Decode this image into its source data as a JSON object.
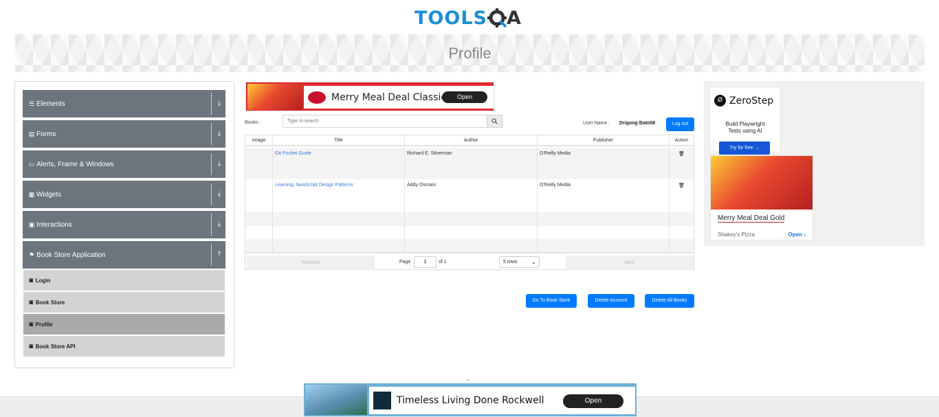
{
  "logo": {
    "text_part": "TOOLS",
    "text_end": "A"
  },
  "page_title": "Profile",
  "sidebar": {
    "groups": [
      {
        "label": "Elements",
        "icon": "list-icon",
        "arrow": "download-arrow-icon"
      },
      {
        "label": "Forms",
        "icon": "file-icon",
        "arrow": "download-arrow-icon"
      },
      {
        "label": "Alerts, Frame & Windows",
        "icon": "window-icon",
        "arrow": "download-arrow-icon"
      },
      {
        "label": "Widgets",
        "icon": "grid-icon",
        "arrow": "download-arrow-icon"
      },
      {
        "label": "Interactions",
        "icon": "interaction-icon",
        "arrow": "download-arrow-icon"
      },
      {
        "label": "Book Store Application",
        "icon": "book-icon",
        "arrow": "upload-arrow-icon"
      }
    ],
    "items": [
      {
        "label": "Login",
        "active": false
      },
      {
        "label": "Book Store",
        "active": false
      },
      {
        "label": "Profile",
        "active": true
      },
      {
        "label": "Book Store API",
        "active": false
      }
    ]
  },
  "ads": {
    "top": {
      "text": "Merry Meal Deal Classic",
      "button": "Open"
    },
    "right_zero": {
      "brand": "ZeroStep",
      "tagline": "Build Playwright Tests using AI",
      "button": "Try for free →"
    },
    "right_meal": {
      "title": "Merry Meal Deal Gold",
      "advertiser": "Shakey's Pizza",
      "open": "Open"
    },
    "bottom": {
      "text": "Timeless Living Done Rockwell",
      "button": "Open"
    }
  },
  "profile": {
    "books_label": "Books :",
    "search_placeholder": "Type to search",
    "user_name_label": "User Name :",
    "user_name_value": "Drigong Bato08",
    "logout_label": "Log out"
  },
  "table": {
    "headers": [
      "Image",
      "Title",
      "Author",
      "Publisher",
      "Action"
    ],
    "rows": [
      {
        "image": "",
        "title": "Git Pocket Guide",
        "author": "Richard E. Silverman",
        "publisher": "O'Reilly Media",
        "action": "delete-icon"
      },
      {
        "image": "",
        "title": "Learning JavaScript Design Patterns",
        "author": "Addy Osmani",
        "publisher": "O'Reilly Media",
        "action": "delete-icon"
      }
    ],
    "pagination": {
      "previous": "Previous",
      "page_label": "Page",
      "page_value": "1",
      "of_label": "of 1",
      "rows_option": "5 rows",
      "next": "Next"
    }
  },
  "actions": {
    "go_to_store": "Go To Book Store",
    "delete_account": "Delete Account",
    "delete_all_books": "Delete All Books"
  }
}
